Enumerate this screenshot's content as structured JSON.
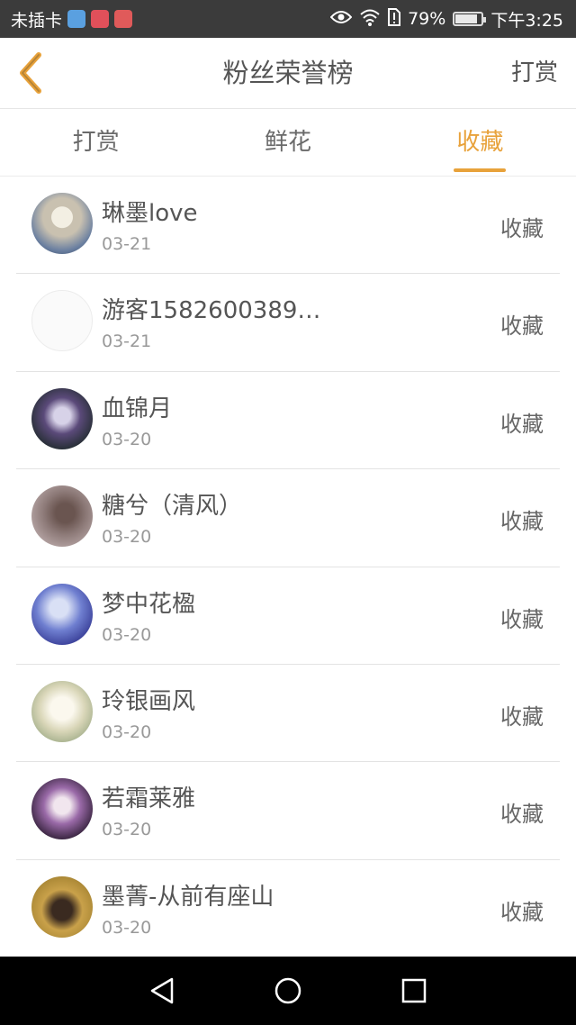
{
  "status_bar": {
    "carrier": "未插卡",
    "battery_percent": "79%",
    "battery_level": 0.79,
    "time": "下午3:25"
  },
  "header": {
    "title": "粉丝荣誉榜",
    "action": "打赏"
  },
  "tabs": [
    {
      "label": "打赏",
      "active": false
    },
    {
      "label": "鲜花",
      "active": false
    },
    {
      "label": "收藏",
      "active": true
    }
  ],
  "fans": [
    {
      "name": "琳墨love",
      "date": "03-21",
      "action": "收藏"
    },
    {
      "name": "游客1582600389…",
      "date": "03-21",
      "action": "收藏"
    },
    {
      "name": "血锦月",
      "date": "03-20",
      "action": "收藏"
    },
    {
      "name": "糖兮（清风）",
      "date": "03-20",
      "action": "收藏"
    },
    {
      "name": "梦中花楹",
      "date": "03-20",
      "action": "收藏"
    },
    {
      "name": "玲银画风",
      "date": "03-20",
      "action": "收藏"
    },
    {
      "name": "若霜莱雅",
      "date": "03-20",
      "action": "收藏"
    },
    {
      "name": "墨菁-从前有座山",
      "date": "03-20",
      "action": "收藏"
    }
  ],
  "colors": {
    "accent": "#e8a23b",
    "status_bar": "#3b3b3b",
    "nav_bar": "#000000"
  }
}
